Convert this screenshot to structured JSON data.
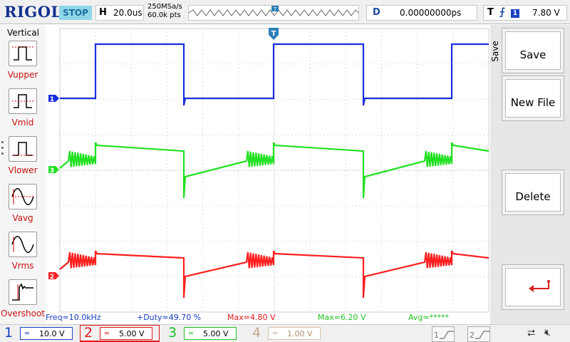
{
  "header": {
    "brand": "RIGOL",
    "run_state": "STOP",
    "horizontal_key": "H",
    "timebase": "20.0us",
    "sample_rate": "250MSa/s",
    "memory_depth": "60.0k pts",
    "delay_key": "D",
    "delay": "0.00000000ps",
    "trigger_key": "T",
    "trigger_source": "1",
    "trigger_level": "7.80 V"
  },
  "left_panel": {
    "title": "Vertical",
    "items": [
      {
        "label": "Vupper",
        "icon": "vupper-icon"
      },
      {
        "label": "Vmid",
        "icon": "vmid-icon"
      },
      {
        "label": "Vlower",
        "icon": "vlower-icon"
      },
      {
        "label": "Vavg",
        "icon": "vavg-icon"
      },
      {
        "label": "Vrms",
        "icon": "vrms-icon"
      },
      {
        "label": "Overshoot",
        "icon": "overshoot-icon"
      }
    ]
  },
  "right_panel": {
    "menu_title": "Save",
    "buttons": [
      {
        "label": "Save"
      },
      {
        "label": "New File"
      },
      {
        "label": "Delete"
      },
      {
        "label": "",
        "icon": "return-arrow-icon"
      }
    ]
  },
  "waveforms": {
    "channels": [
      {
        "id": "1",
        "color": "#1a2fe0",
        "marker_label": "1"
      },
      {
        "id": "3",
        "color": "#22e022",
        "marker_label": "3"
      },
      {
        "id": "2",
        "color": "#ff2020",
        "marker_label": "2"
      }
    ],
    "trigger_marker_label": "T"
  },
  "measurements": {
    "freq": "Freq=10.0kHz",
    "duty": "+Duty=49.70 %",
    "max2": "Max=4.80 V",
    "max3": "Max=6.20 V",
    "avg": "Avg=*****"
  },
  "channels_bar": [
    {
      "num": "1",
      "scale": "10.0 V",
      "color": "#1a3fc0"
    },
    {
      "num": "2",
      "scale": "5.00 V",
      "color": "#e01818"
    },
    {
      "num": "3",
      "scale": "5.00 V",
      "color": "#22c022"
    },
    {
      "num": "4",
      "scale": "1.00 V",
      "color": "#c8a888"
    }
  ],
  "math_slots": [
    "1",
    "2"
  ],
  "colors": {
    "brand": "#14318f",
    "ch1": "#1a2fe0",
    "ch2": "#ff2020",
    "ch3": "#22e022",
    "ch4_inactive": "#c8a888",
    "measure_label": "#c81010"
  }
}
